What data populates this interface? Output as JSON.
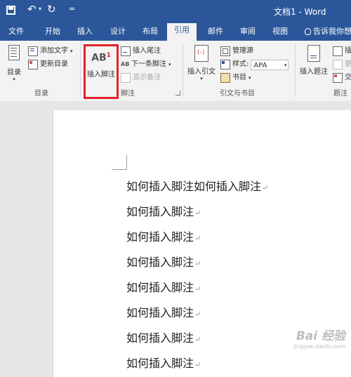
{
  "window": {
    "title": "文档1 - Word"
  },
  "quick_access": {
    "save": "save-icon",
    "undo": "undo-icon",
    "redo": "redo-icon",
    "customize": "="
  },
  "tabs": [
    "文件",
    "开始",
    "插入",
    "设计",
    "布局",
    "引用",
    "邮件",
    "审阅",
    "视图"
  ],
  "active_tab": "引用",
  "tell_me": "告诉我你想",
  "ribbon": {
    "toc_group": {
      "toc_button": "目录",
      "add_text": "添加文字",
      "update_toc": "更新目录",
      "label": "目录"
    },
    "footnote_group": {
      "insert_footnote_icon_text": "AB",
      "insert_footnote_sup": "1",
      "insert_footnote": "插入脚注",
      "insert_endnote": "插入尾注",
      "next_footnote": "下一条脚注",
      "show_notes": "显示备注",
      "label": "脚注"
    },
    "citation_group": {
      "insert_citation": "插入引文",
      "manage_sources": "管理源",
      "style_label": "样式:",
      "style_value": "APA",
      "bibliography": "书目",
      "label": "引文与书目"
    },
    "caption_group": {
      "insert_caption": "插入题注",
      "label": "题注",
      "partial_1": "插",
      "partial_2": "更",
      "partial_3": "交"
    }
  },
  "document": {
    "lines": [
      "如何插入脚注如何插入脚注",
      "如何插入脚注",
      "如何插入脚注",
      "如何插入脚注",
      "如何插入脚注",
      "如何插入脚注",
      "如何插入脚注",
      "如何插入脚注"
    ],
    "paragraph_mark": "↵"
  },
  "watermark": {
    "text": "Bai 经验",
    "url": "jingyan.baidu.com"
  },
  "colors": {
    "accent": "#2b579a",
    "highlight": "#e0232a"
  }
}
